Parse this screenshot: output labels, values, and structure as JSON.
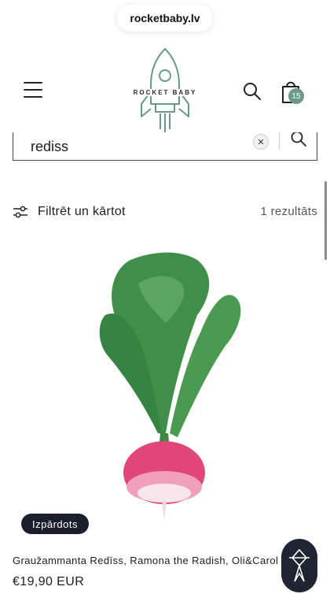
{
  "browser": {
    "url": "rocketbaby.lv"
  },
  "header": {
    "logo_text": "ROCKET BABY",
    "cart_count": "15",
    "brand_color": "#6a9a86"
  },
  "search": {
    "query": "rediss",
    "clear_icon": "close-icon",
    "submit_icon": "search-icon"
  },
  "filter": {
    "label": "Filtrēt un kārtot",
    "icon": "sliders-icon",
    "result_count": "1 rezultāts"
  },
  "products": [
    {
      "badge": "Izpārdots",
      "title": "Graužammanta Redīss, Ramona the Radish, Oli&Carol",
      "price": "€19,90 EUR"
    }
  ],
  "chat": {
    "icon": "chat-logo-icon"
  }
}
